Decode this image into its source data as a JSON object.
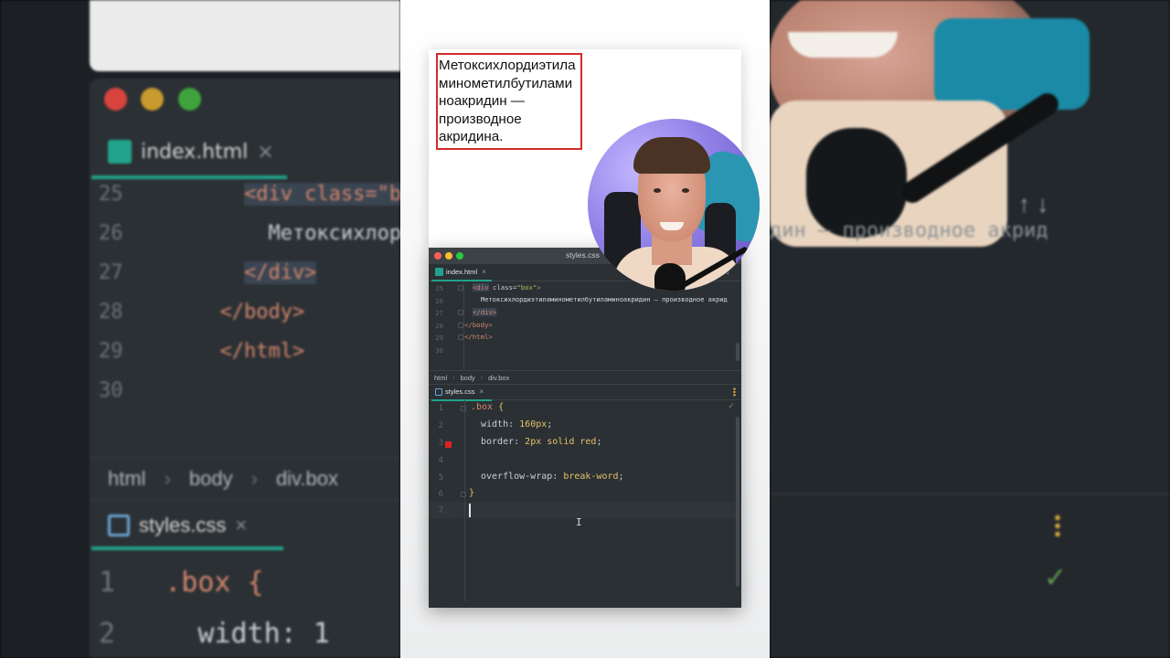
{
  "preview": {
    "box_text": "Метоксихлордиэтиламинометилбутиламиноакридин — производное акридина."
  },
  "window": {
    "title": "styles.css"
  },
  "html_tab": {
    "label": "index.html",
    "close": "×"
  },
  "html_lines": {
    "n25": "25",
    "n26": "26",
    "n27": "27",
    "n28": "28",
    "n29": "29",
    "n30": "30",
    "l25_open": "<",
    "l25_tag": "div",
    "l25_attr": " class=",
    "l25_str": "\"box\"",
    "l25_close": ">",
    "l26_text": "Метоксихлордиэтиламинометилбутиламиноакридин — производное акрид",
    "l27": "</div>",
    "l28": "</body>",
    "l29": "</html>"
  },
  "breadcrumbs": {
    "c1": "html",
    "c2": "body",
    "c3": "div.box",
    "sep": "›"
  },
  "css_tab": {
    "label": "styles.css",
    "close": "×"
  },
  "css_lines": {
    "n1": "1",
    "n2": "2",
    "n3": "3",
    "n4": "4",
    "n5": "5",
    "n6": "6",
    "n7": "7",
    "l1_sel": ".box",
    "l1_brace": " {",
    "l2_prop": "width: ",
    "l2_val": "160px",
    "l2_end": ";",
    "l3_prop": "border: ",
    "l3_val": "2px solid red",
    "l3_end": ";",
    "l5_prop": "overflow-wrap: ",
    "l5_val": "break-word",
    "l5_end": ";",
    "l6": "}"
  },
  "background_left": {
    "tab": "index.html",
    "tab_close": "×",
    "n25": "25",
    "n26": "26",
    "n27": "27",
    "n28": "28",
    "n29": "29",
    "n30": "30",
    "l25": "<div class=\"b",
    "l26": "Метоксихлор",
    "l27": "</div>",
    "l28": "</body>",
    "l29": "</html>",
    "crumb1": "html",
    "crumb2": "body",
    "crumb3": "div.box",
    "sep": "›",
    "css_tab": "styles.css",
    "c1": "1",
    "c1_text": ".box {",
    "c2": "2",
    "c2_text": "width: 1"
  },
  "background_right": {
    "codeline": "дин — производное акрид",
    "arrows": "↑  ↓",
    "check": "✓"
  },
  "icons": {
    "check": "✓",
    "up_down": "↑ ↓",
    "ibeam": "I"
  },
  "colors": {
    "accent": "#21a38b",
    "box_border": "#d52b2b",
    "editor_bg": "#2b3034",
    "traffic_red": "#ff5f57",
    "traffic_yellow": "#febc2e",
    "traffic_green": "#28c840"
  }
}
